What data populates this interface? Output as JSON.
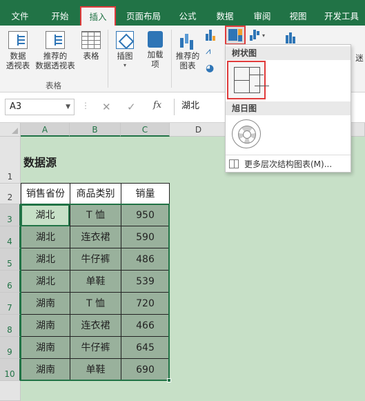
{
  "ribbon_tabs": [
    "文件",
    "开始",
    "插入",
    "页面布局",
    "公式",
    "数据",
    "审阅",
    "视图",
    "开发工具"
  ],
  "active_tab": "插入",
  "ribbon": {
    "pivot_table": "数据\n透视表",
    "recommended_pivot": "推荐的\n数据透视表",
    "table": "表格",
    "group_tables": "表格",
    "illustrations": "插图",
    "addins": "加载\n项",
    "recommended_charts": "推荐的\n图表",
    "more": "迷"
  },
  "name_box": "A3",
  "formula_value": "湖北",
  "columns": [
    "A",
    "B",
    "C",
    "D"
  ],
  "rows": [
    "1",
    "2",
    "3",
    "4",
    "5",
    "6",
    "7",
    "8",
    "9",
    "10"
  ],
  "sheet": {
    "title": "数据源",
    "headers": [
      "销售省份",
      "商品类别",
      "销量"
    ],
    "data": [
      [
        "湖北",
        "T 恤",
        "950"
      ],
      [
        "湖北",
        "连衣裙",
        "590"
      ],
      [
        "湖北",
        "牛仔裤",
        "486"
      ],
      [
        "湖北",
        "单鞋",
        "539"
      ],
      [
        "湖南",
        "T 恤",
        "720"
      ],
      [
        "湖南",
        "连衣裙",
        "466"
      ],
      [
        "湖南",
        "牛仔裤",
        "645"
      ],
      [
        "湖南",
        "单鞋",
        "690"
      ]
    ]
  },
  "dropdown": {
    "treemap_label": "树状图",
    "sunburst_label": "旭日图",
    "more_label": "更多层次结构图表(M)..."
  },
  "colors": {
    "excel_green": "#217346",
    "highlight_red": "#e03b3b",
    "selection_fill": "#99b19c"
  }
}
